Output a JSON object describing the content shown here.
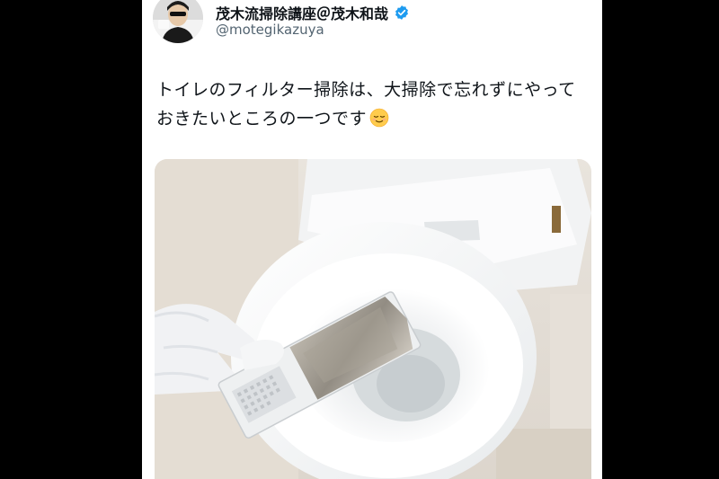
{
  "tweet": {
    "display_name": "茂木流掃除講座＠茂木和哉",
    "verified": true,
    "handle": "@motegikazuya",
    "text": "トイレのフィルター掃除は、大掃除で忘れずにやっておきたいところの一つです",
    "emoji": "relieved-face-emoji"
  },
  "icons": {
    "verified": "verified-badge-icon",
    "avatar": "avatar"
  },
  "colors": {
    "background": "#000000",
    "card": "#ffffff",
    "name": "#0f1419",
    "handle": "#536471",
    "verified": "#1d9bf0"
  }
}
